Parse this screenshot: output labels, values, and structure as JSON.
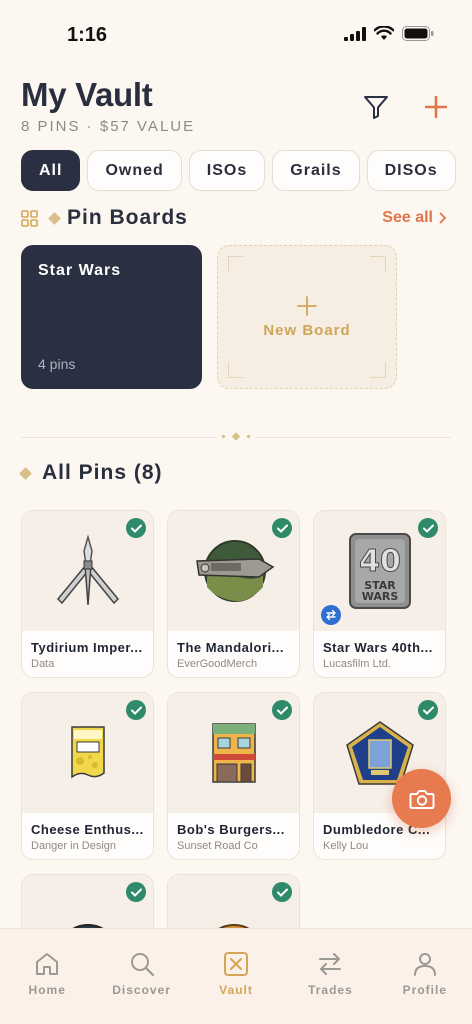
{
  "status": {
    "time": "1:16"
  },
  "header": {
    "title": "My Vault",
    "subtitle": "8 PINS · $57 VALUE"
  },
  "filters": [
    "All",
    "Owned",
    "ISOs",
    "Grails",
    "DISOs"
  ],
  "boards_section": {
    "title": "Pin Boards",
    "see_all": "See all"
  },
  "boards": [
    {
      "name": "Star Wars",
      "count": "4 pins"
    }
  ],
  "new_board": {
    "label": "New Board"
  },
  "pins_section": {
    "title": "All Pins (8)"
  },
  "pins": [
    {
      "name": "Tydirium Imper...",
      "maker": "Data"
    },
    {
      "name": "The Mandalori...",
      "maker": "EverGoodMerch"
    },
    {
      "name": "Star Wars 40th...",
      "maker": "Lucasfilm Ltd."
    },
    {
      "name": "Cheese Enthus...",
      "maker": "Danger in Design"
    },
    {
      "name": "Bob's Burgers...",
      "maker": "Sunset Road Co"
    },
    {
      "name": "Dumbledore C...",
      "maker": "Kelly Lou"
    }
  ],
  "tabs": [
    {
      "label": "Home",
      "icon": "home-icon"
    },
    {
      "label": "Discover",
      "icon": "search-icon"
    },
    {
      "label": "Vault",
      "icon": "vault-icon"
    },
    {
      "label": "Trades",
      "icon": "trades-icon"
    },
    {
      "label": "Profile",
      "icon": "profile-icon"
    }
  ],
  "colors": {
    "accent": "#e0764a",
    "gold": "#d4a656",
    "navy": "#2a3042",
    "check": "#2f8a6a"
  }
}
